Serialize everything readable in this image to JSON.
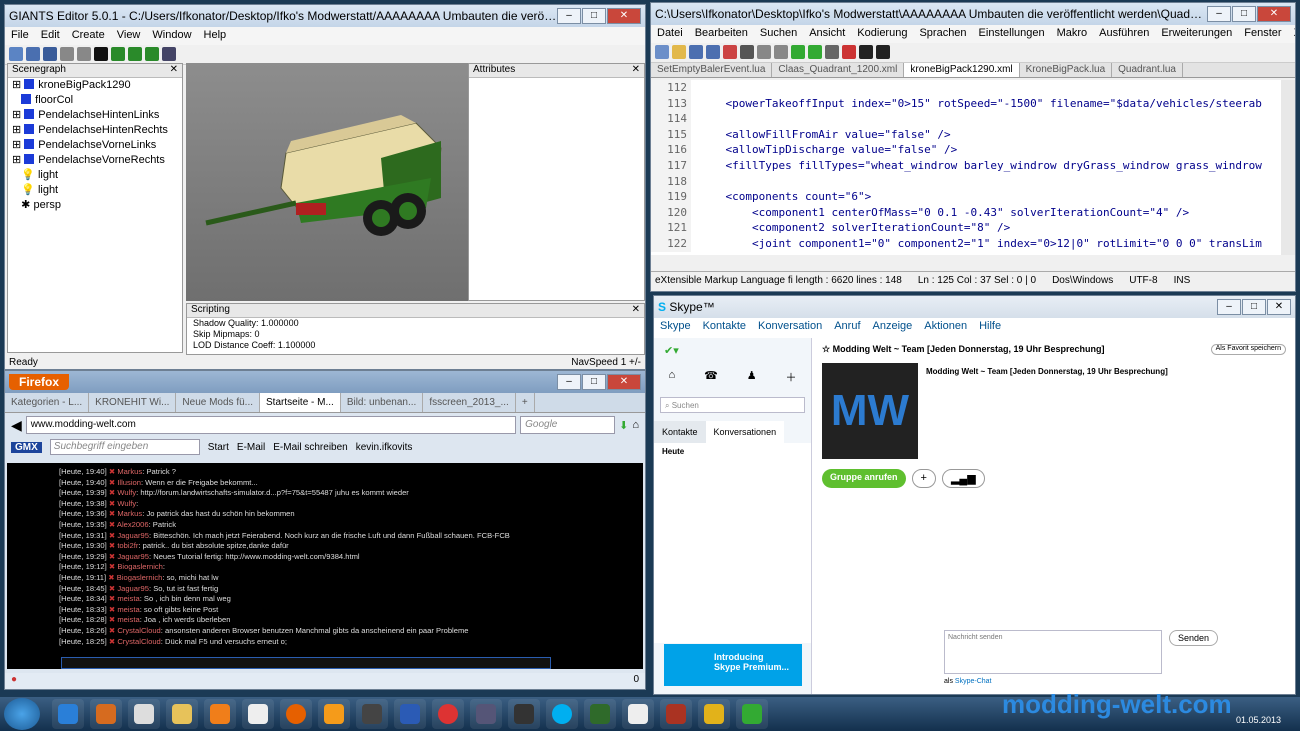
{
  "giants": {
    "title": "GIANTS Editor 5.0.1 - C:/Users/Ifkonator/Desktop/Ifko's Modwerstatt/AAAAAAAA Umbauten die veröffentlicht werden/...",
    "menu": [
      "File",
      "Edit",
      "Create",
      "View",
      "Window",
      "Help"
    ],
    "scenegraph_title": "Scenegraph",
    "tree": [
      "kroneBigPack1290",
      "floorCol",
      "PendelachseHintenLinks",
      "PendelachseHintenRechts",
      "PendelachseVorneLinks",
      "PendelachseVorneRechts",
      "light",
      "light",
      "persp"
    ],
    "attributes_title": "Attributes",
    "scripting_title": "Scripting",
    "scripting_lines": [
      "Shadow Quality: 1.000000",
      "Skip Mipmaps: 0",
      "LOD Distance Coeff: 1.100000"
    ],
    "status_left": "Ready",
    "status_right": "NavSpeed 1 +/-"
  },
  "npp": {
    "title": "C:\\Users\\Ifkonator\\Desktop\\Ifko's Modwerstatt\\AAAAAAAA Umbauten die veröffentlicht werden\\Quaderballentechnik_P...",
    "menu": [
      "Datei",
      "Bearbeiten",
      "Suchen",
      "Ansicht",
      "Kodierung",
      "Sprachen",
      "Einstellungen",
      "Makro",
      "Ausführen",
      "Erweiterungen",
      "Fenster",
      "X"
    ],
    "tabs": [
      "SetEmptyBalerEvent.lua",
      "Claas_Quadrant_1200.xml",
      "kroneBigPack1290.xml",
      "KroneBigPack.lua",
      "Quadrant.lua"
    ],
    "lines": [
      {
        "n": "112",
        "t": ""
      },
      {
        "n": "113",
        "t": "    <powerTakeoffInput index=\"0>15\" rotSpeed=\"-1500\" filename=\"$data/vehicles/steerab"
      },
      {
        "n": "114",
        "t": ""
      },
      {
        "n": "115",
        "t": "    <allowFillFromAir value=\"false\" />"
      },
      {
        "n": "116",
        "t": "    <allowTipDischarge value=\"false\" />"
      },
      {
        "n": "117",
        "t": "    <fillTypes fillTypes=\"wheat_windrow barley_windrow dryGrass_windrow grass_windrow"
      },
      {
        "n": "118",
        "t": ""
      },
      {
        "n": "119",
        "t": "    <components count=\"6\">"
      },
      {
        "n": "120",
        "t": "        <component1 centerOfMass=\"0 0.1 -0.43\" solverIterationCount=\"4\" />"
      },
      {
        "n": "121",
        "t": "        <component2 solverIterationCount=\"8\" />"
      },
      {
        "n": "122",
        "t": "        <joint component1=\"0\" component2=\"1\" index=\"0>12|0\" rotLimit=\"0 0 0\" transLim"
      }
    ],
    "status": [
      "eXtensible Markup Language fi length : 6620    lines : 148",
      "Ln : 125    Col : 37    Sel : 0 | 0",
      "Dos\\Windows",
      "UTF-8",
      "INS"
    ]
  },
  "skype": {
    "title": "Skype™",
    "menu": [
      "Skype",
      "Kontakte",
      "Konversation",
      "Anruf",
      "Anzeige",
      "Aktionen",
      "Hilfe"
    ],
    "search_placeholder": "Suchen",
    "tab_contacts": "Kontakte",
    "tab_conv": "Konversationen",
    "today": "Heute",
    "chat_title": "Modding Welt ~ Team [Jeden Donnerstag, 19 Uhr Besprechung]",
    "fav": "Als Favorit speichern",
    "group_name": "Modding Welt ~ Team [Jeden Donnerstag, 19 Uhr Besprechung]",
    "call": "Gruppe anrufen",
    "msg_placeholder": "Nachricht senden",
    "send": "Senden",
    "ad1": "Introducing",
    "ad2": "Skype Premium...",
    "as": "als",
    "skype_chat": "Skype-Chat"
  },
  "firefox": {
    "title": "Firefox",
    "tabs": [
      "Kategorien - L...",
      "KRONEHIT Wi...",
      "Neue Mods fü...",
      "Startseite - M...",
      "Bild: unbenan...",
      "fsscreen_2013_..."
    ],
    "url": "www.modding-welt.com",
    "search": "Google",
    "gmx": "GMX",
    "gmx_search": "Suchbegriff eingeben",
    "start": "Start",
    "email": "E-Mail",
    "email_write": "E-Mail schreiben",
    "user": "kevin.ifkovits",
    "chat": [
      {
        "t": "[Heute, 19:40]",
        "n": "Markus",
        "m": ": Patrick ?"
      },
      {
        "t": "[Heute, 19:40]",
        "n": "Illusion",
        "m": ": Wenn er die Freigabe bekommt..."
      },
      {
        "t": "[Heute, 19:39]",
        "n": "Wulfy",
        "m": ": http://forum.landwirtschafts-simulator.d...p?f=75&t=55487 juhu es kommt wieder"
      },
      {
        "t": "[Heute, 19:38]",
        "n": "Wulfy",
        "m": ":"
      },
      {
        "t": "[Heute, 19:36]",
        "n": "Markus",
        "m": ": Jo patrick das hast du schön hin bekommen"
      },
      {
        "t": "[Heute, 19:35]",
        "n": "Alex2006",
        "m": ": Patrick"
      },
      {
        "t": "[Heute, 19:31]",
        "n": "Jaguar95",
        "m": ": Bitteschön. Ich mach jetzt Feierabend. Noch kurz an die frische Luft und dann Fußball schauen. FCB-FCB"
      },
      {
        "t": "[Heute, 19:30]",
        "n": "tobi2fr",
        "m": ": patrick.. du bist absolute spitze,danke dafür"
      },
      {
        "t": "[Heute, 19:29]",
        "n": "Jaguar95",
        "m": ": Neues Tutorial fertig: http://www.modding-welt.com/9384.html"
      },
      {
        "t": "[Heute, 19:12]",
        "n": "Biogaslernich",
        "m": ":"
      },
      {
        "t": "[Heute, 19:11]",
        "n": "Biogaslernich",
        "m": ": so, michi hat lw"
      },
      {
        "t": "[Heute, 18:45]",
        "n": "Jaguar95",
        "m": ": So, tut ist fast fertig"
      },
      {
        "t": "[Heute, 18:34]",
        "n": "meista",
        "m": ": So , ich bin denn mal weg"
      },
      {
        "t": "[Heute, 18:33]",
        "n": "meista",
        "m": ": so oft gibts keine Post"
      },
      {
        "t": "[Heute, 18:28]",
        "n": "meista",
        "m": ": Joa , ich werds überleben"
      },
      {
        "t": "[Heute, 18:26]",
        "n": "CrystalCloud",
        "m": ": ansonsten anderen Browser benutzen Manchmal gibts da anscheinend ein paar Probleme"
      },
      {
        "t": "[Heute, 18:25]",
        "n": "CrystalCloud",
        "m": ": Dück mal F5 und versuchs erneut o;"
      }
    ],
    "status_count": "0"
  },
  "watermark": "modding-welt.com",
  "clock_time": "19:40",
  "clock_date": "01.05.2013"
}
